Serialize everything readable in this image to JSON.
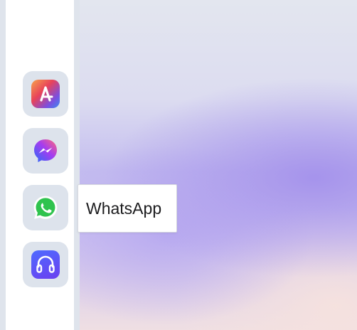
{
  "dock": {
    "items": [
      {
        "app": "astra",
        "icon": "astra-logo-icon"
      },
      {
        "app": "messenger",
        "icon": "messenger-icon"
      },
      {
        "app": "whatsapp",
        "icon": "whatsapp-icon"
      },
      {
        "app": "headset",
        "icon": "headphones-icon"
      }
    ]
  },
  "tooltip": {
    "label": "WhatsApp"
  },
  "colors": {
    "dock_tile": "#dde3ec",
    "whatsapp_green": "#2fc34e",
    "messenger_blue": "#2a6cf7",
    "messenger_purple": "#a53cf0",
    "headset_blue": "#4e6bff"
  }
}
